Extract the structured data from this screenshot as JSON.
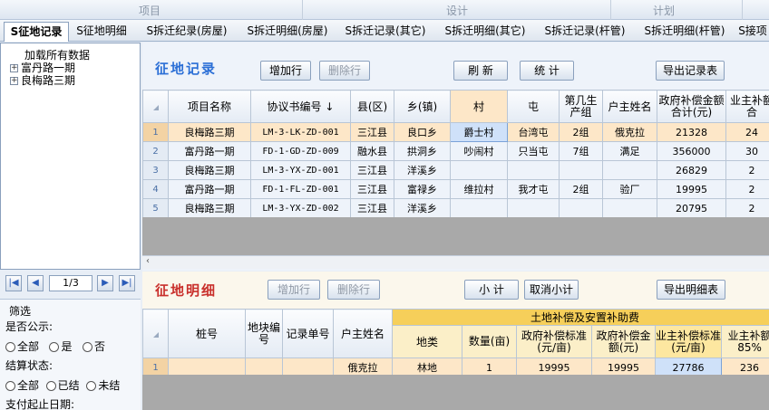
{
  "top_strip": {
    "col1": "项目",
    "col2": "设计",
    "col3": "计划"
  },
  "tabs": [
    "S征地记录",
    "S征地明细",
    "S拆迁纪录(房屋)",
    "S拆迁明细(房屋)",
    "S拆迁记录(其它)",
    "S拆迁明细(其它)",
    "S拆迁记录(杆管)",
    "S拆迁明细(杆管)",
    "S接项"
  ],
  "tree": {
    "root": "加载所有数据",
    "items": [
      "富丹路一期",
      "良梅路三期"
    ],
    "expander": "+"
  },
  "pager": {
    "first": "|◀",
    "prev": "◀",
    "page": "1/3",
    "next": "▶",
    "last": "▶|"
  },
  "filter": {
    "title": "筛选",
    "public_label": "是否公示:",
    "public_options": [
      "全部",
      "是",
      "否"
    ],
    "settle_label": "结算状态:",
    "settle_options": [
      "全部",
      "已结",
      "未结"
    ],
    "date_label": "支付起止日期:"
  },
  "record_panel": {
    "title": "征地记录",
    "add": "增加行",
    "delete": "删除行",
    "refresh": "刷 新",
    "stats": "统 计",
    "export": "导出记录表",
    "columns": [
      "项目名称",
      "协议书编号",
      "县(区)",
      "乡(镇)",
      "村",
      "屯",
      "第几生产组",
      "户主姓名",
      "政府补偿金额合计(元)",
      "业主补额合"
    ],
    "sort_arrow": "↓",
    "rows": [
      {
        "n": "1",
        "proj": "良梅路三期",
        "code": "LM-3-LK-ZD-001",
        "county": "三江县",
        "town": "良口乡",
        "village": "爵士村",
        "tun": "台湾屯",
        "group": "2组",
        "owner": "俄克拉",
        "amount": "21328",
        "extra": "24"
      },
      {
        "n": "2",
        "proj": "富丹路一期",
        "code": "FD-1-GD-ZD-009",
        "county": "融水县",
        "town": "拱洞乡",
        "village": "吵闹村",
        "tun": "只当屯",
        "group": "7组",
        "owner": "满足",
        "amount": "356000",
        "extra": "30"
      },
      {
        "n": "3",
        "proj": "良梅路三期",
        "code": "LM-3-YX-ZD-001",
        "county": "三江县",
        "town": "洋溪乡",
        "village": "",
        "tun": "",
        "group": "",
        "owner": "",
        "amount": "26829",
        "extra": "2"
      },
      {
        "n": "4",
        "proj": "富丹路一期",
        "code": "FD-1-FL-ZD-001",
        "county": "三江县",
        "town": "富禄乡",
        "village": "维拉村",
        "tun": "我才屯",
        "group": "2组",
        "owner": "验厂",
        "amount": "19995",
        "extra": "2"
      },
      {
        "n": "5",
        "proj": "良梅路三期",
        "code": "LM-3-YX-ZD-002",
        "county": "三江县",
        "town": "洋溪乡",
        "village": "",
        "tun": "",
        "group": "",
        "owner": "",
        "amount": "20795",
        "extra": "2"
      }
    ]
  },
  "detail_panel": {
    "title": "征地明细",
    "add": "增加行",
    "delete": "删除行",
    "subtotal": "小 计",
    "cancel_subtotal": "取消小计",
    "export": "导出明细表",
    "group_header": "土地补偿及安置补助费",
    "columns": [
      "桩号",
      "地块编号",
      "记录单号",
      "户主姓名",
      "地类",
      "数量(亩)",
      "政府补偿标准(元/亩)",
      "政府补偿金额(元)",
      "业主补偿标准(元/亩)",
      "业主补额85%"
    ],
    "rows": [
      {
        "n": "1",
        "stake": "",
        "plot": "",
        "rec": "",
        "owner": "俄克拉",
        "type": "林地",
        "qty": "1",
        "std": "19995",
        "amt": "19995",
        "ostd": "27786",
        "oamt": "236"
      }
    ]
  },
  "colors": {
    "accent_blue": "#2b6fd6",
    "accent_red": "#c9302c",
    "selected_row": "#fde7c8"
  }
}
